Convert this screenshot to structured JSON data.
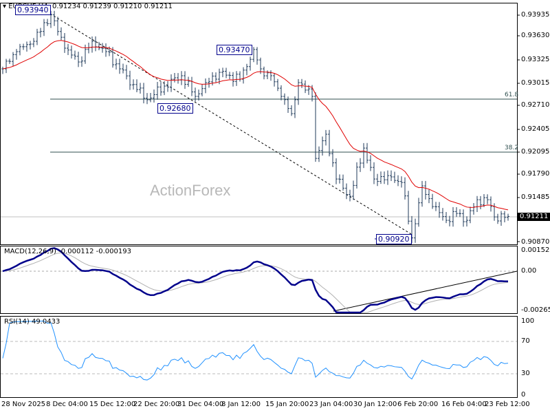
{
  "header": {
    "symbol": "EURCHF,H4",
    "ohlc": "0.91234 0.91239 0.91210 0.91211"
  },
  "watermark": "ActionForex",
  "price_axis": [
    "0.93935",
    "0.93630",
    "0.93325",
    "0.93015",
    "0.92710",
    "0.92405",
    "0.92095",
    "0.91790",
    "0.91485",
    "0.90870"
  ],
  "current_price": "0.91211",
  "annotations": {
    "high1": "0.93940",
    "low1": "0.92680",
    "high2": "0.93470",
    "low2": "0.90920"
  },
  "fib": {
    "f618": "61.8",
    "f382": "38.2"
  },
  "macd": {
    "label": "MACD(12,26,9) -0.000112 -0.000193",
    "axis": [
      "0.001522",
      "0.00",
      "-0.002657"
    ]
  },
  "rsi": {
    "label": "RSI(14) 49.0433",
    "axis": [
      "100",
      "70",
      "30",
      "0"
    ]
  },
  "x_axis": [
    "28 Nov 2025",
    "8 Dec 04:00",
    "15 Dec 12:00",
    "22 Dec 20:00",
    "31 Dec 04:00",
    "8 Jan 12:00",
    "15 Jan 20:00",
    "23 Jan 04:00",
    "30 Jan 12:00",
    "6 Feb 20:00",
    "16 Feb 04:00",
    "23 Feb 12:00"
  ],
  "colors": {
    "bars": "#1f3a5a",
    "ma": "#e00000",
    "macd": "#00008b",
    "signal": "#b0b0b0",
    "rsi": "#1e90ff"
  },
  "chart_data": {
    "type": "line",
    "title": "EURCHF,H4",
    "ylim": [
      0.9087,
      0.93935
    ],
    "keypoints": [
      [
        0,
        0.93208
      ],
      [
        4,
        0.93441
      ],
      [
        9,
        0.93581
      ],
      [
        14,
        0.9394
      ],
      [
        18,
        0.93488
      ],
      [
        22,
        0.93301
      ],
      [
        26,
        0.93581
      ],
      [
        30,
        0.93441
      ],
      [
        34,
        0.93208
      ],
      [
        39,
        0.92928
      ],
      [
        42,
        0.92789
      ],
      [
        47,
        0.92975
      ],
      [
        52,
        0.93115
      ],
      [
        56,
        0.92835
      ],
      [
        59,
        0.93022
      ],
      [
        63,
        0.93161
      ],
      [
        69,
        0.93068
      ],
      [
        73,
        0.9347
      ],
      [
        75,
        0.93208
      ],
      [
        78,
        0.93115
      ],
      [
        81,
        0.92835
      ],
      [
        84,
        0.92602
      ],
      [
        86,
        0.93022
      ],
      [
        90,
        0.92835
      ],
      [
        91,
        0.91996
      ],
      [
        94,
        0.92323
      ],
      [
        97,
        0.91717
      ],
      [
        101,
        0.91484
      ],
      [
        105,
        0.92136
      ],
      [
        108,
        0.91717
      ],
      [
        112,
        0.91763
      ],
      [
        116,
        0.9167
      ],
      [
        119,
        0.9092
      ],
      [
        122,
        0.91624
      ],
      [
        125,
        0.91344
      ],
      [
        129,
        0.91158
      ],
      [
        132,
        0.91251
      ],
      [
        135,
        0.91158
      ],
      [
        138,
        0.91437
      ],
      [
        141,
        0.91437
      ],
      [
        143,
        0.91204
      ],
      [
        147,
        0.91211
      ]
    ]
  }
}
